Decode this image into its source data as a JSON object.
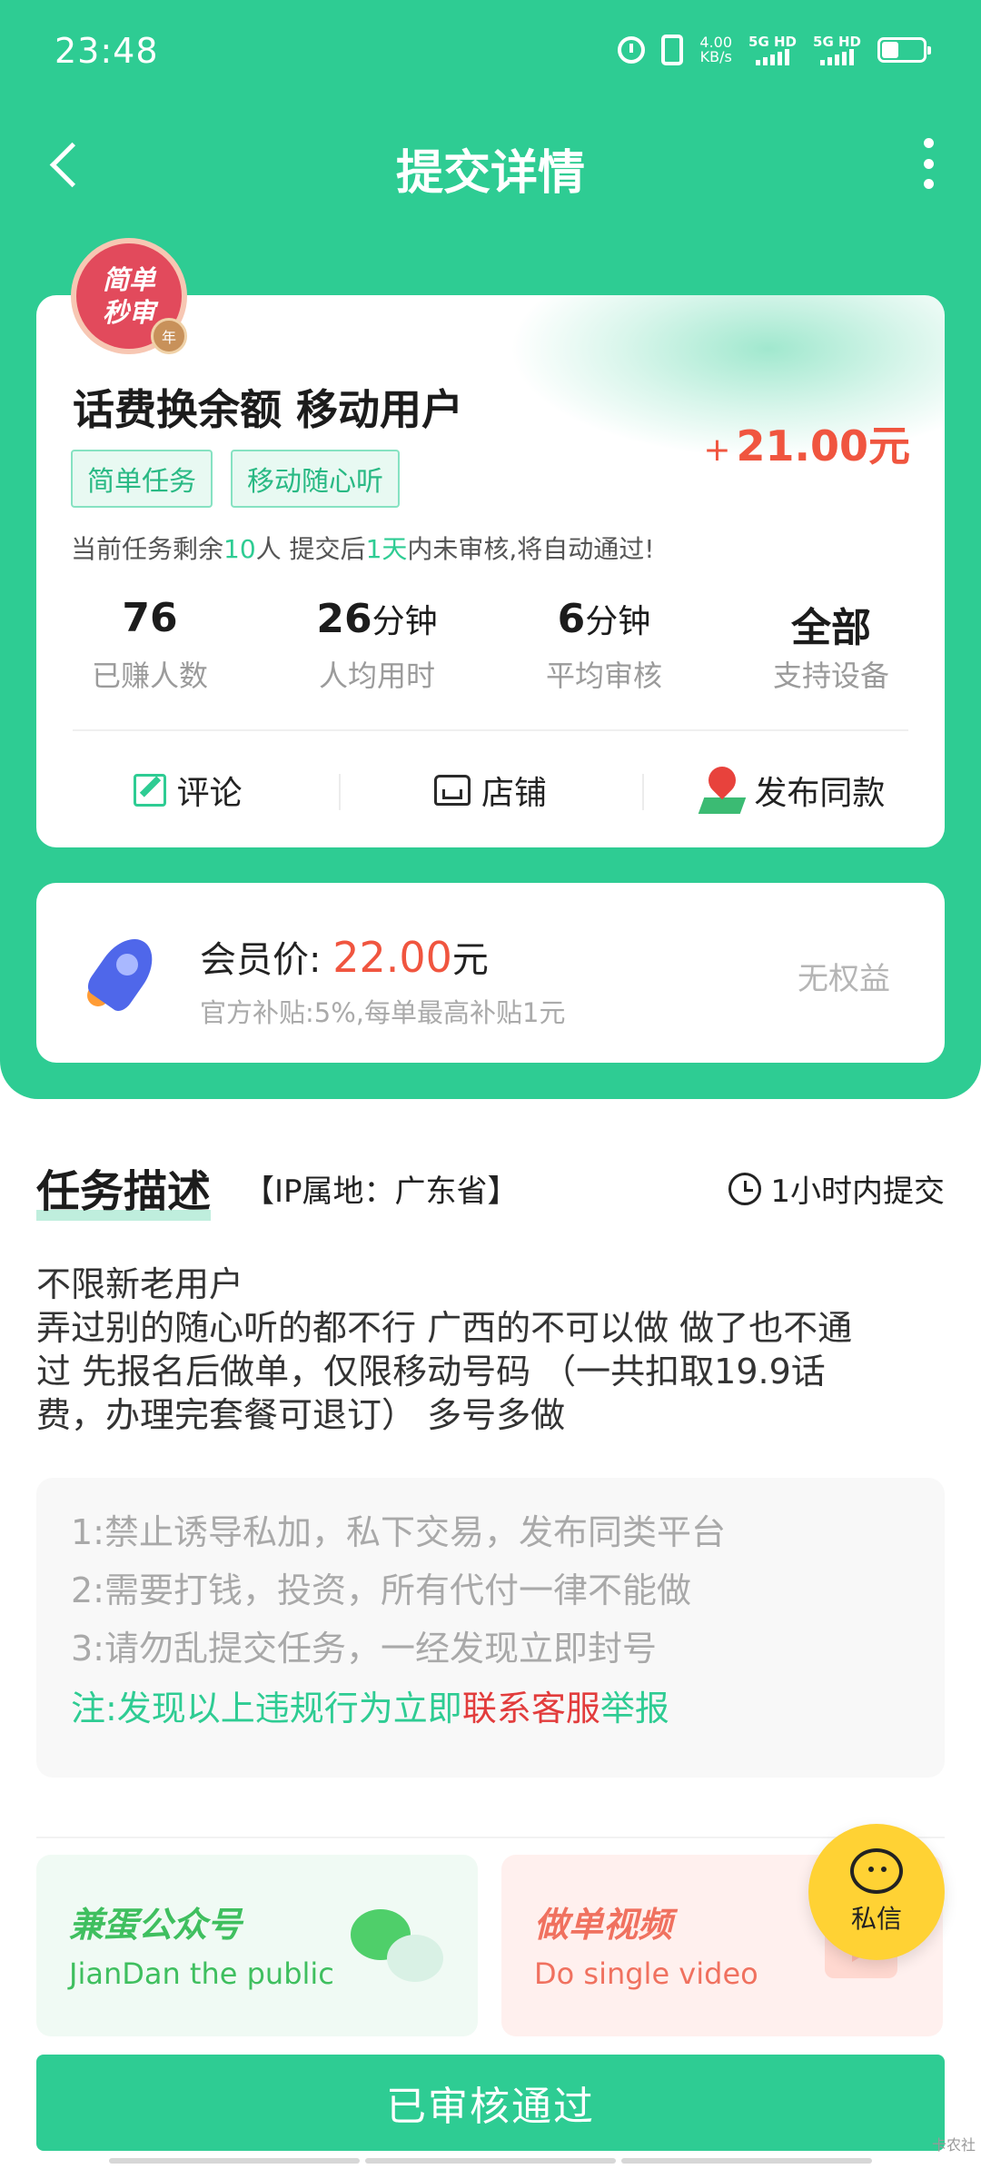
{
  "status_bar": {
    "time": "23:48",
    "speed_value": "4.00",
    "speed_unit": "KB/s",
    "signal_1": "5G HD",
    "signal_2": "5G HD"
  },
  "nav": {
    "title": "提交详情"
  },
  "task": {
    "badge_line1": "简单",
    "badge_line2": "秒审",
    "badge_medal": "年",
    "title": "话费换余额 移动用户",
    "reward_sign": "+",
    "reward": "21.00元",
    "tags": [
      "简单任务",
      "移动随心听"
    ],
    "notice_prefix": "当前任务剩余",
    "notice_count": "10",
    "notice_mid": "人  提交后",
    "notice_days": "1天",
    "notice_suffix": "内未审核,将自动通过!",
    "stats": [
      {
        "value": "76",
        "unit": "",
        "label": "已赚人数"
      },
      {
        "value": "26",
        "unit": "分钟",
        "label": "人均用时"
      },
      {
        "value": "6",
        "unit": "分钟",
        "label": "平均审核"
      },
      {
        "value": "全部",
        "unit": "",
        "label": "支持设备"
      }
    ],
    "actions": [
      "评论",
      "店铺",
      "发布同款"
    ]
  },
  "member": {
    "label": "会员价:",
    "price": "22.00",
    "currency": "元",
    "subtitle": "官方补贴:5%,每单最高补贴1元",
    "right": "无权益"
  },
  "description": {
    "title": "任务描述",
    "ip": "【IP属地：广东省】",
    "deadline": "1小时内提交",
    "text_lines": [
      "不限新老用户",
      "弄过别的随心听的都不行 广西的不可以做 做了也不通",
      "过 先报名后做单，仅限移动号码 （一共扣取19.9话",
      "费，办理完套餐可退订） 多号多做"
    ],
    "rules": [
      "1:禁止诱导私加，私下交易，发布同类平台",
      "2:需要打钱，投资，所有代付一律不能做",
      "3:请勿乱提交任务，一经发现立即封号"
    ],
    "note_prefix": "注:发现以上违规行为立即",
    "note_link": "联系客服",
    "note_suffix": "举报"
  },
  "promos": {
    "a_title": "兼蛋公众号",
    "a_sub": "JianDan the public",
    "b_title": "做单视频",
    "b_sub": "Do single video"
  },
  "chat": {
    "label": "私信"
  },
  "bottom": {
    "button": "已审核通过",
    "watermark": "卡农社"
  },
  "colors": {
    "primary": "#2ecc93",
    "reward": "#f0553f",
    "link_red": "#e23c3c",
    "chat": "#ffd234"
  }
}
